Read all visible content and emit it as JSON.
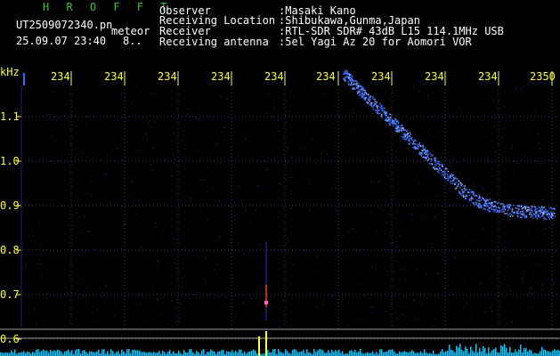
{
  "header": {
    "title": "H R O F F T",
    "filename": "UT2509072340.pn",
    "datetime": "25.09.07 23:40",
    "mode": "meteor",
    "counter": "8.."
  },
  "meta": [
    {
      "label": "Observer",
      "value": ":Masaki Kano"
    },
    {
      "label": "Receiving Location",
      "value": ":Shibukawa,Gunma,Japan"
    },
    {
      "label": "Receiver",
      "value": ":RTL-SDR SDR# 43dB L15 114.1MHz USB"
    },
    {
      "label": "Receiving antenna",
      "value": ":5el Yagi Az 20 for Aomori VOR"
    }
  ],
  "axis": {
    "y_unit": "kHz",
    "y_ticks": [
      "1.1",
      "1.0",
      "0.9",
      "0.8",
      "0.7",
      "0.6"
    ],
    "x_ticks": [
      "234",
      "234",
      "234",
      "234",
      "234",
      "234",
      "234",
      "234",
      "234",
      "2350"
    ]
  },
  "colors": {
    "background": "#000000",
    "grid": "#3a3a7a",
    "signal": "#3a6bff",
    "text_axis": "#ffff33",
    "title": "#2ec42e",
    "meteor": "#ff3333",
    "spectrum_bar": "#ffff33",
    "spectrum_floor": "#00c8ff"
  }
}
